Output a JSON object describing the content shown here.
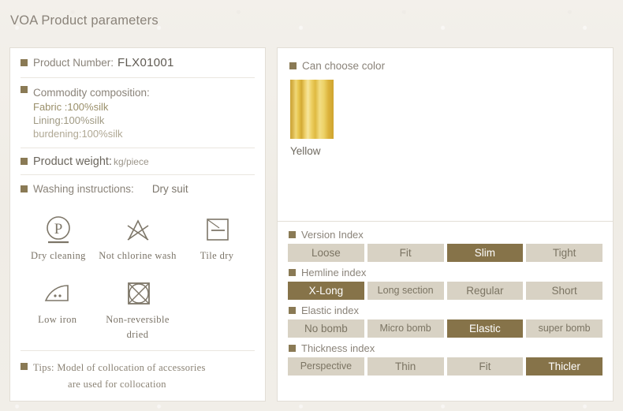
{
  "page": {
    "title": "VOA Product parameters"
  },
  "left": {
    "product_number": {
      "label": "Product Number:",
      "value": "FLX01001"
    },
    "composition": {
      "label": "Commodity composition:",
      "lines": [
        "Fabric  :100%silk",
        "Lining:100%silk",
        "burdening:100%silk"
      ]
    },
    "weight": {
      "label": "Product  weight:",
      "unit": "kg/piece"
    },
    "washing": {
      "label": "Washing instructions:",
      "value": "Dry suit"
    },
    "care_symbols": [
      {
        "icon": "dry-cleaning-icon",
        "label": "Dry cleaning"
      },
      {
        "icon": "no-chlorine-wash-icon",
        "label": "Not chlorine wash"
      },
      {
        "icon": "tile-dry-icon",
        "label": "Tile dry"
      },
      {
        "icon": "low-iron-icon",
        "label": "Low iron"
      },
      {
        "icon": "non-reversible-dried-icon",
        "label": "Non-reversible\ndried"
      }
    ],
    "tips": {
      "label": "Tips:",
      "line1": "Model of collocation of accessories",
      "line2": "are used for collocation"
    }
  },
  "right": {
    "color": {
      "label": "Can choose color",
      "swatch_name": "Yellow",
      "swatch_color": "#e8c74f"
    },
    "indices": [
      {
        "name": "version-index",
        "label": "Version Index",
        "options": [
          "Loose",
          "Fit",
          "Slim",
          "Tight"
        ],
        "selected": "Slim"
      },
      {
        "name": "hemline-index",
        "label": "Hemline index",
        "options": [
          "X-Long",
          "Long  section",
          "Regular",
          "Short"
        ],
        "selected": "X-Long"
      },
      {
        "name": "elastic-index",
        "label": "Elastic index",
        "options": [
          "No  bomb",
          "Micro bomb",
          "Elastic",
          "super  bomb"
        ],
        "selected": "Elastic"
      },
      {
        "name": "thickness-index",
        "label": "Thickness index",
        "options": [
          "Perspective",
          "Thin",
          "Fit",
          "Thicler"
        ],
        "selected": "Thicler"
      }
    ]
  },
  "theme": {
    "accent": "#867349",
    "button_bg": "#d8d2c4",
    "bullet": "#8a7a55",
    "background": "#f2efe9"
  }
}
